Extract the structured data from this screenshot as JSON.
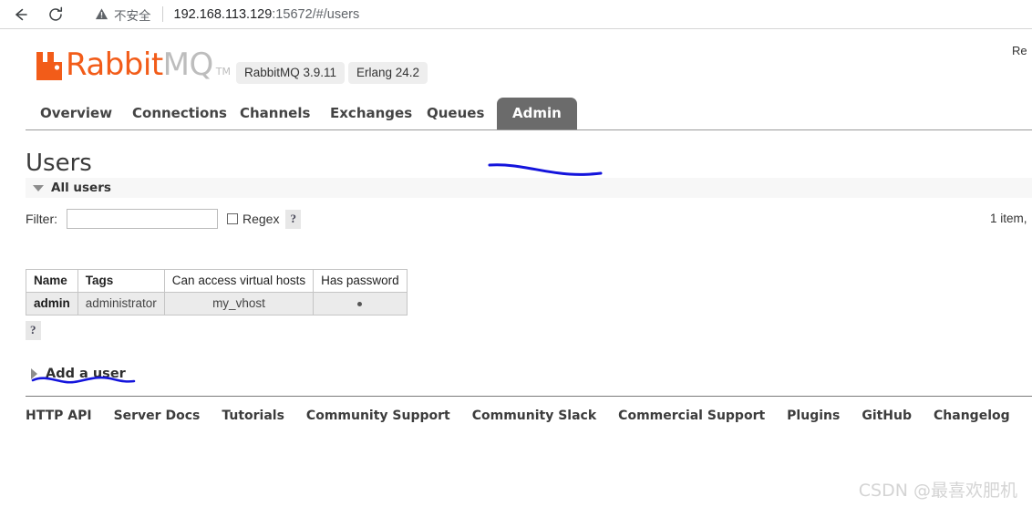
{
  "browser": {
    "back_icon": "back-arrow-icon",
    "reload_icon": "reload-icon",
    "warning_icon": "warning-triangle-icon",
    "security_label": "不安全",
    "url_host": "192.168.113.129",
    "url_rest": ":15672/#/users"
  },
  "header": {
    "logo_rabbit": "Rabbit",
    "logo_mq": "MQ",
    "logo_tm": "TM",
    "badges": [
      {
        "label": "RabbitMQ 3.9.11"
      },
      {
        "label": "Erlang 24.2"
      }
    ],
    "refresh_note": "Re"
  },
  "nav": {
    "tabs": [
      {
        "label": "Overview",
        "active": false
      },
      {
        "label": "Connections",
        "active": false
      },
      {
        "label": "Channels",
        "active": false
      },
      {
        "label": "Exchanges",
        "active": false
      },
      {
        "label": "Queues",
        "active": false
      },
      {
        "label": "Admin",
        "active": true
      }
    ]
  },
  "main": {
    "page_title": "Users",
    "section_label": "All users",
    "filter": {
      "label": "Filter:",
      "value": "",
      "placeholder": "",
      "regex_label": "Regex",
      "regex_checked": false,
      "help_label": "?"
    },
    "item_count": "1 item,",
    "table": {
      "columns": [
        "Name",
        "Tags",
        "Can access virtual hosts",
        "Has password"
      ],
      "rows": [
        {
          "name": "admin",
          "tags": "administrator",
          "vhosts": "my_vhost",
          "has_password": "•"
        }
      ],
      "help_label": "?"
    },
    "add_user_label": "Add a user"
  },
  "footer": {
    "links": [
      "HTTP API",
      "Server Docs",
      "Tutorials",
      "Community Support",
      "Community Slack",
      "Commercial Support",
      "Plugins",
      "GitHub",
      "Changelog"
    ]
  },
  "watermark": "CSDN @最喜欢肥机",
  "colors": {
    "brand_orange": "#f25c19",
    "logo_gray": "#bdbdbd",
    "active_tab_bg": "#6b6b6b",
    "annotation_blue": "#1414dc",
    "row_bg": "#ebebeb",
    "section_bg": "#f7f7f7"
  }
}
